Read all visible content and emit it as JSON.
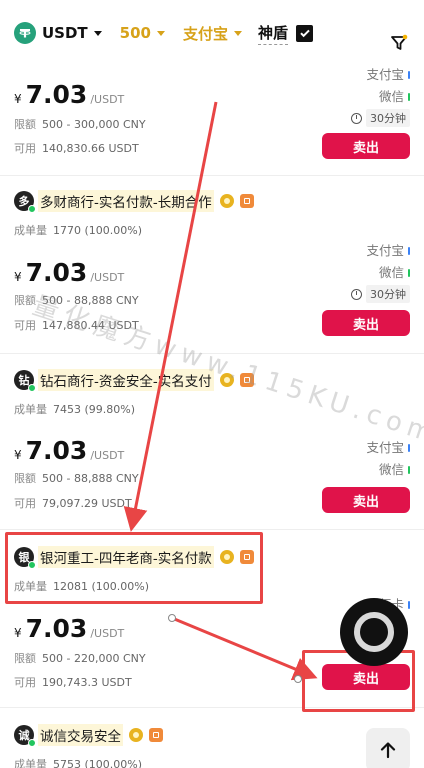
{
  "filters": {
    "coin": "USDT",
    "amount": "500",
    "pay_method": "支付宝",
    "shield": "神盾",
    "shield_checked": true
  },
  "labels": {
    "limit": "限额",
    "available": "可用",
    "volume": "成单量",
    "unit": "/USDT",
    "currency": "¥",
    "sell": "卖出",
    "time": "30分钟"
  },
  "listings": [
    {
      "merchant": "",
      "volume": "",
      "rate": "",
      "price": "7.03",
      "limit": "500 - 300,000 CNY",
      "available": "140,830.66 USDT",
      "pay_methods": [
        "支付宝",
        "微信"
      ]
    },
    {
      "merchant": "多财商行-实名付款-长期合作",
      "avatar": "多",
      "volume": "1770",
      "rate": "(100.00%)",
      "price": "7.03",
      "limit": "500 - 88,888 CNY",
      "available": "147,880.44 USDT",
      "pay_methods": [
        "支付宝",
        "微信"
      ]
    },
    {
      "merchant": "钻石商行-资金安全-实名支付",
      "avatar": "钻",
      "volume": "7453",
      "rate": "(99.80%)",
      "price": "7.03",
      "limit": "500 - 88,888 CNY",
      "available": "79,097.29 USDT",
      "pay_methods": [
        "支付宝",
        "微信"
      ]
    },
    {
      "merchant": "银河重工-四年老商-实名付款",
      "avatar": "银",
      "volume": "12081",
      "rate": "(100.00%)",
      "price": "7.03",
      "limit": "500 - 220,000 CNY",
      "available": "190,743.3 USDT",
      "pay_methods": [
        "银行卡"
      ]
    },
    {
      "merchant": "诚信交易安全",
      "avatar": "诚",
      "volume": "5753",
      "rate": "(100.00%)",
      "price": "",
      "limit": "",
      "available": "",
      "pay_methods": []
    }
  ],
  "watermark": "量化魔方www.115KU.com",
  "colors": {
    "accent_gold": "#d7a21a",
    "sell_button": "#e0134a",
    "annotation_red": "#e84545",
    "tether_green": "#26a17b"
  }
}
